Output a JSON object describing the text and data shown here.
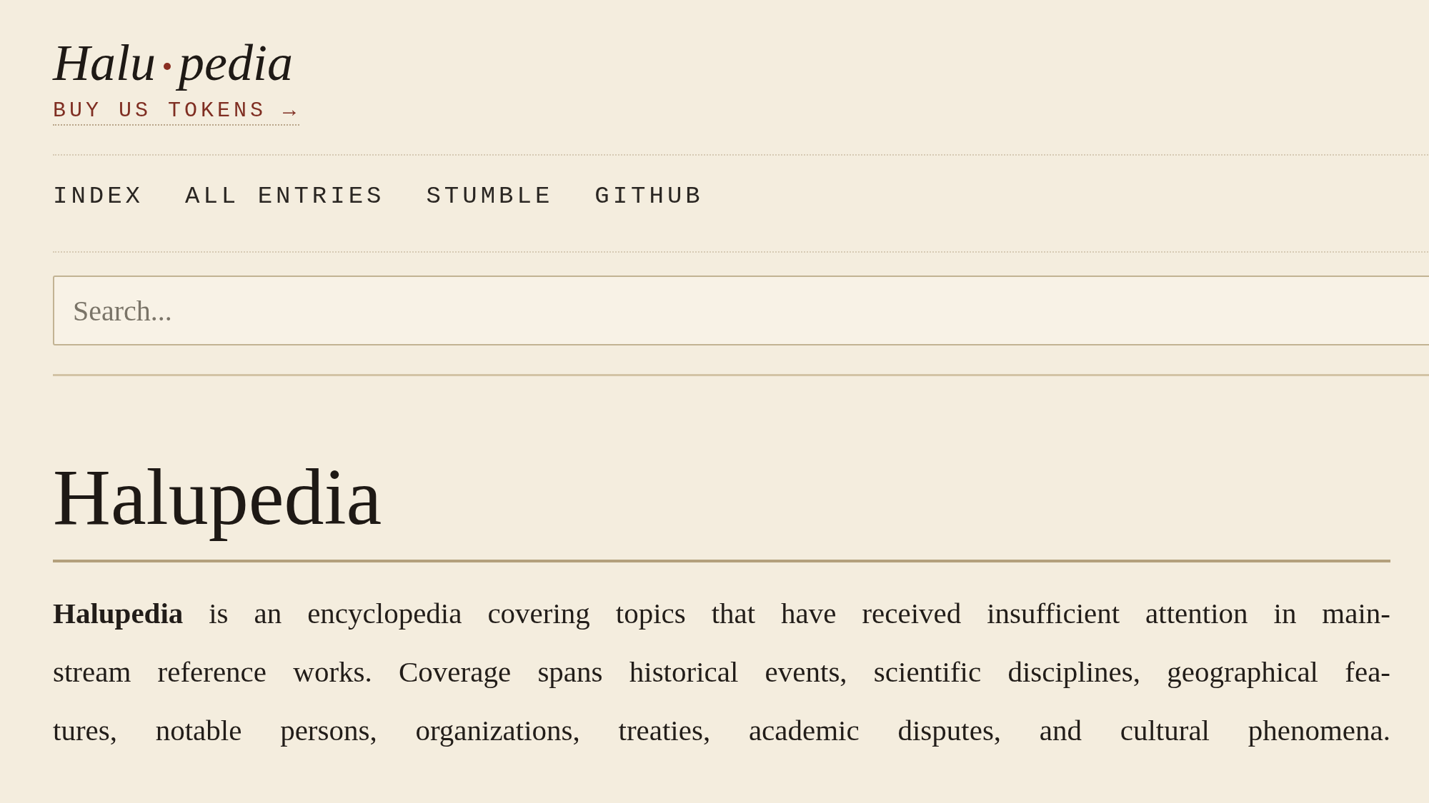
{
  "header": {
    "logo": {
      "left": "Halu",
      "right": "pedia"
    },
    "promo_link": "BUY US TOKENS →"
  },
  "nav": [
    {
      "label": "INDEX"
    },
    {
      "label": "ALL ENTRIES"
    },
    {
      "label": "STUMBLE"
    },
    {
      "label": "GITHUB"
    }
  ],
  "search": {
    "placeholder": "Search..."
  },
  "article": {
    "title": "Halupedia",
    "intro_lines": [
      "**Halupedia** is an encyclopedia covering topics that have received insufficient attention in main-",
      "stream reference works. Coverage spans historical events, scientific disciplines, geographical fea-",
      "tures, notable persons, organizations, treaties, academic disputes, and cultural phenomena."
    ]
  }
}
